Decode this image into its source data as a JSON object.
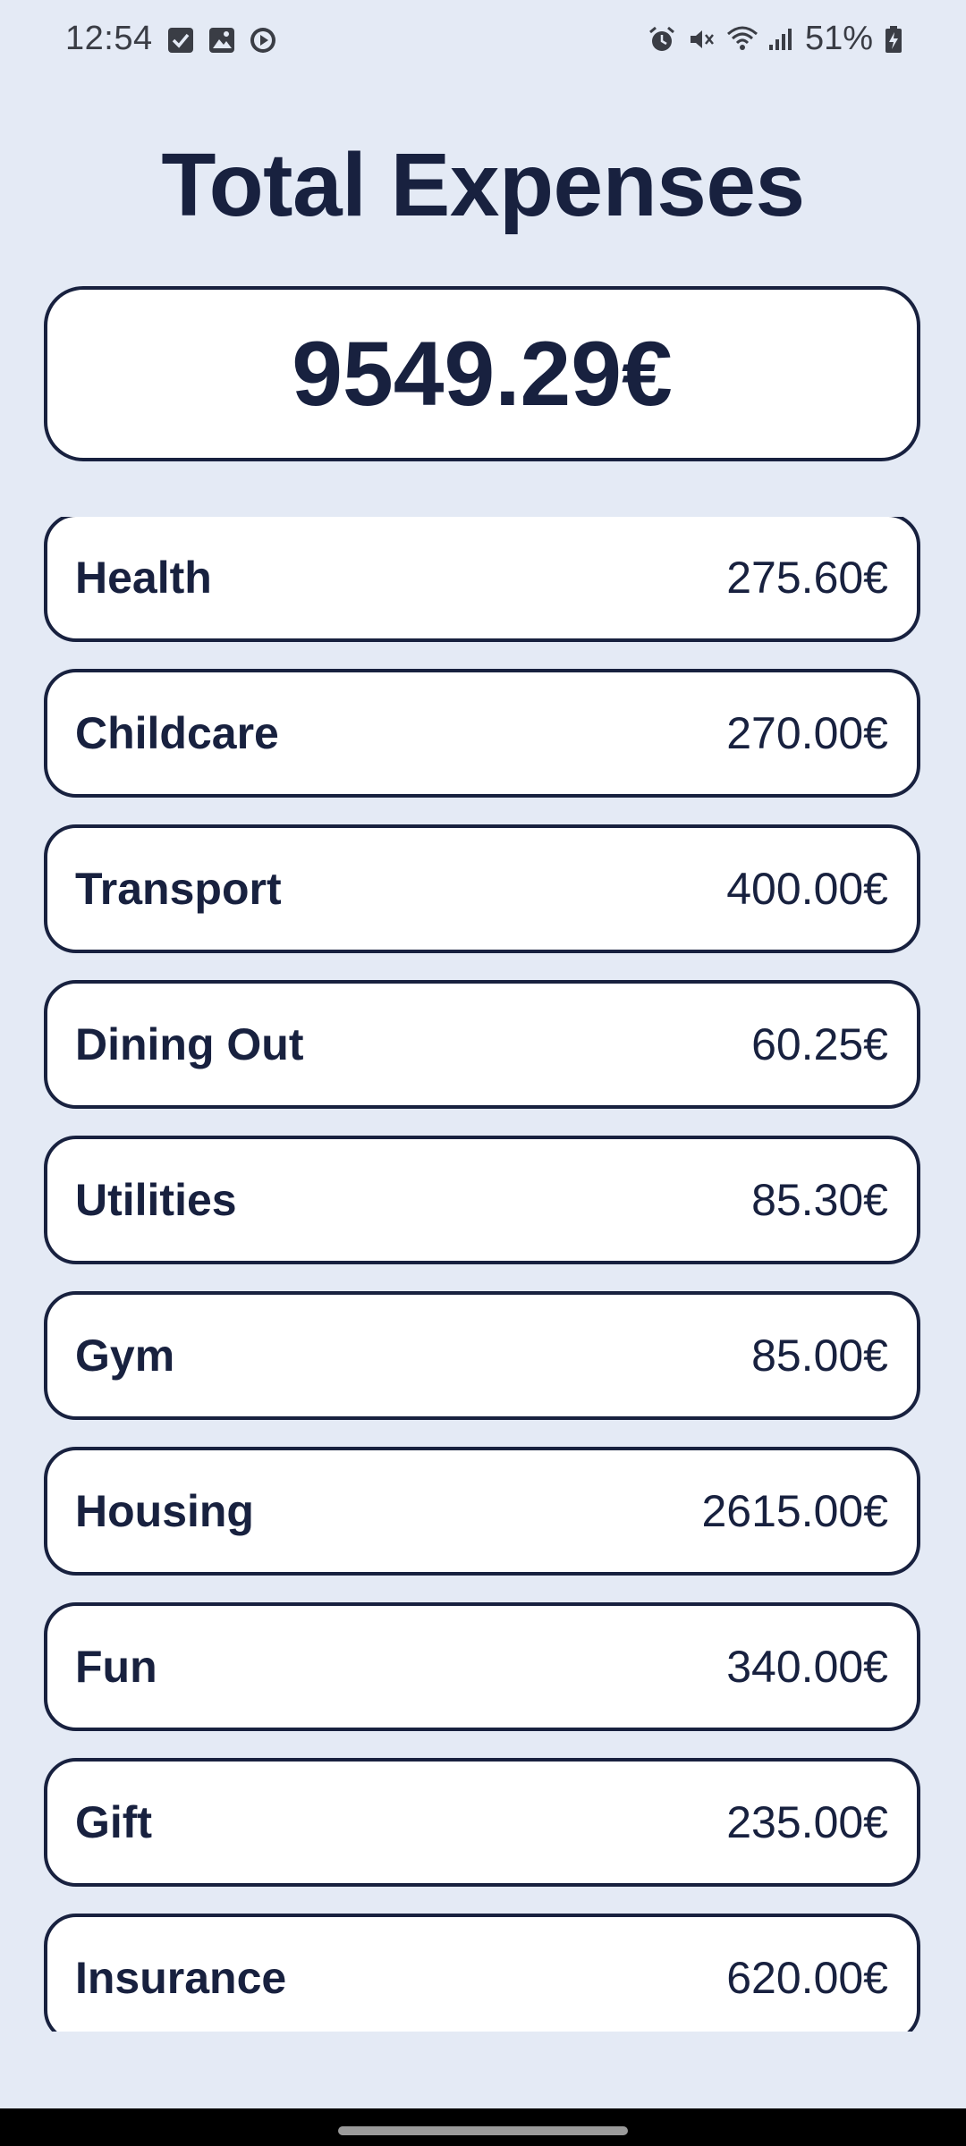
{
  "status_bar": {
    "time": "12:54",
    "left_icons": [
      "checkbox-notification-icon",
      "image-notification-icon",
      "media-play-notification-icon"
    ],
    "right_icons": [
      "alarm-icon",
      "mute-icon",
      "wifi-icon",
      "signal-icon"
    ],
    "battery_text": "51%"
  },
  "page": {
    "title": "Total Expenses",
    "total": "9549.29€"
  },
  "expenses": [
    {
      "name": "Health",
      "value": "275.60€"
    },
    {
      "name": "Childcare",
      "value": "270.00€"
    },
    {
      "name": "Transport",
      "value": "400.00€"
    },
    {
      "name": "Dining Out",
      "value": "60.25€"
    },
    {
      "name": "Utilities",
      "value": "85.30€"
    },
    {
      "name": "Gym",
      "value": "85.00€"
    },
    {
      "name": "Housing",
      "value": "2615.00€"
    },
    {
      "name": "Fun",
      "value": "340.00€"
    },
    {
      "name": "Gift",
      "value": "235.00€"
    },
    {
      "name": "Insurance",
      "value": "620.00€"
    }
  ],
  "colors": {
    "background": "#e4eaf5",
    "text": "#18213f",
    "card": "#ffffff",
    "border": "#18213f"
  }
}
